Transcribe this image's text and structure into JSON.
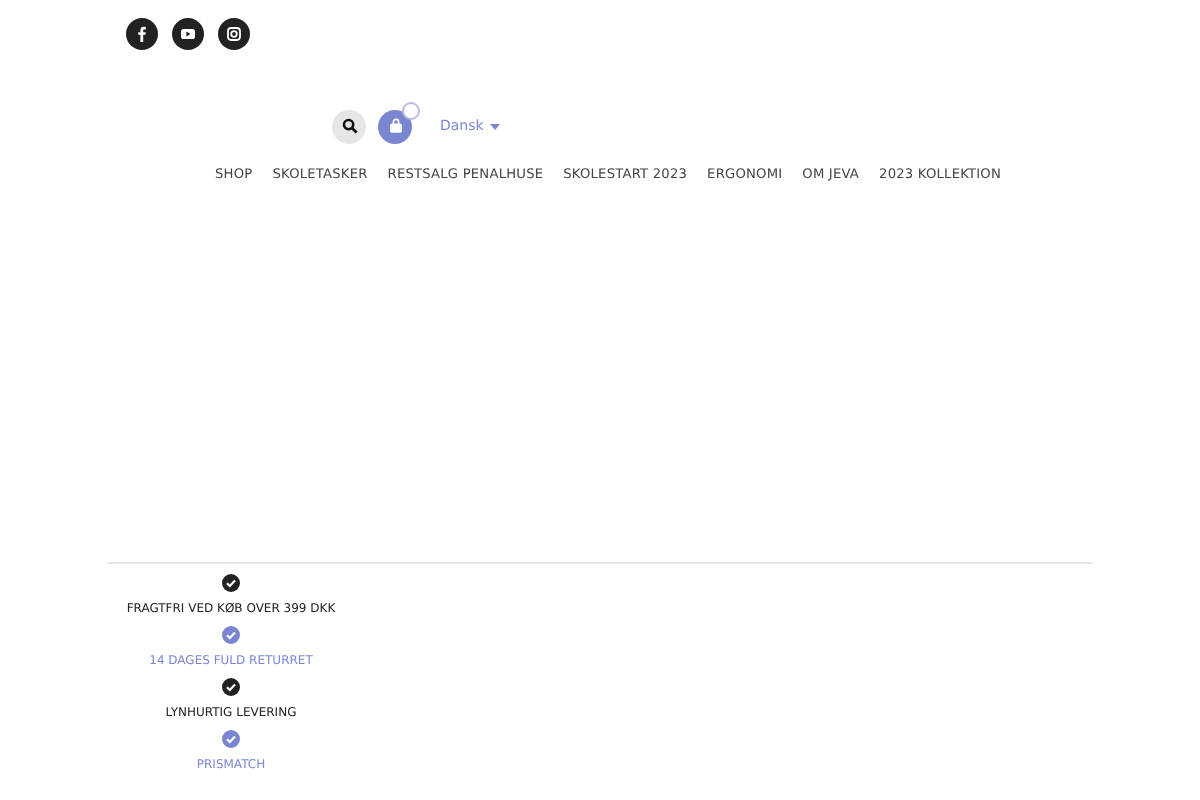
{
  "language": {
    "label": "Dansk"
  },
  "nav": [
    {
      "label": "SHOP"
    },
    {
      "label": "SKOLETASKER"
    },
    {
      "label": "RESTSALG PENALHUSE"
    },
    {
      "label": "SKOLESTART 2023"
    },
    {
      "label": "ERGONOMI"
    },
    {
      "label": "OM JEVA"
    },
    {
      "label": "2023 KOLLEKTION"
    }
  ],
  "usps": [
    {
      "label": "FRAGTFRI VED KØB OVER 399 DKK",
      "color": "#222222"
    },
    {
      "label": "14 DAGES FULD RETURRET",
      "color": "#7b86d0"
    },
    {
      "label": "LYNHURTIG LEVERING",
      "color": "#222222"
    },
    {
      "label": "PRISMATCH",
      "color": "#7b86d0"
    }
  ]
}
